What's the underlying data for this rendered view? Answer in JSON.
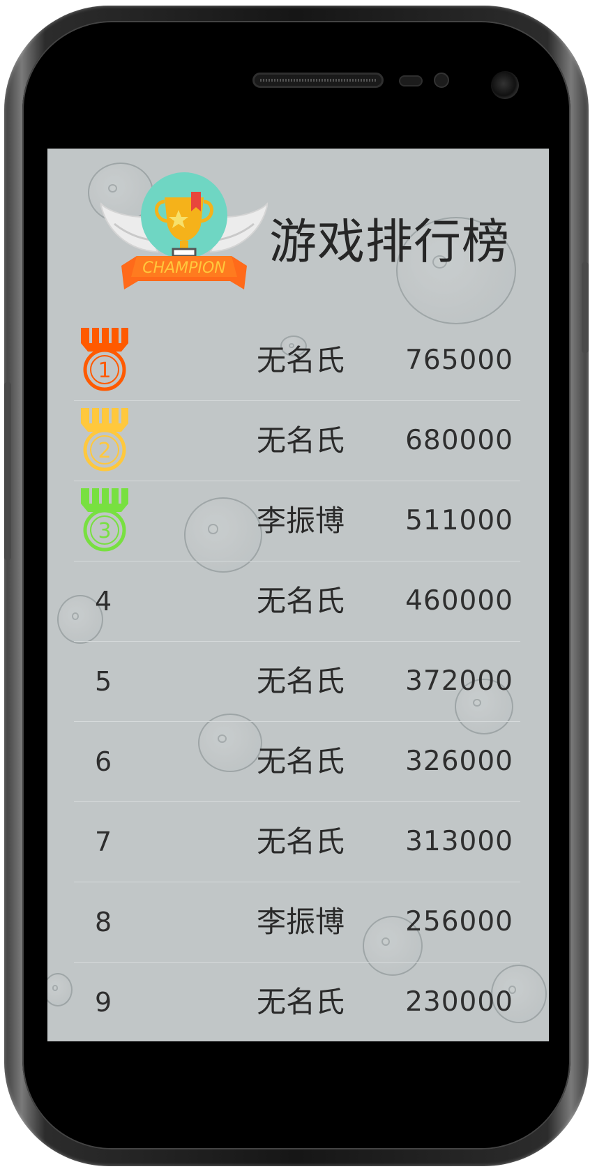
{
  "app": {
    "title": "游戏排行榜",
    "logo_banner_text": "CHAMPION"
  },
  "leaderboard": {
    "rows": [
      {
        "rank": "1",
        "medal": "medal-1-icon",
        "medal_color": "#ff5a00",
        "name": "无名氏",
        "score": "765000"
      },
      {
        "rank": "2",
        "medal": "medal-2-icon",
        "medal_color": "#ffc83d",
        "name": "无名氏",
        "score": "680000"
      },
      {
        "rank": "3",
        "medal": "medal-3-icon",
        "medal_color": "#78e040",
        "name": "李振博",
        "score": "511000"
      },
      {
        "rank": "4",
        "name": "无名氏",
        "score": "460000"
      },
      {
        "rank": "5",
        "name": "无名氏",
        "score": "372000"
      },
      {
        "rank": "6",
        "name": "无名氏",
        "score": "326000"
      },
      {
        "rank": "7",
        "name": "无名氏",
        "score": "313000"
      },
      {
        "rank": "8",
        "name": "李振博",
        "score": "256000"
      },
      {
        "rank": "9",
        "name": "无名氏",
        "score": "230000"
      }
    ]
  },
  "colors": {
    "screen_background": "#c1c6c7",
    "text": "#2a2a2a",
    "divider": "#d6dadb"
  }
}
